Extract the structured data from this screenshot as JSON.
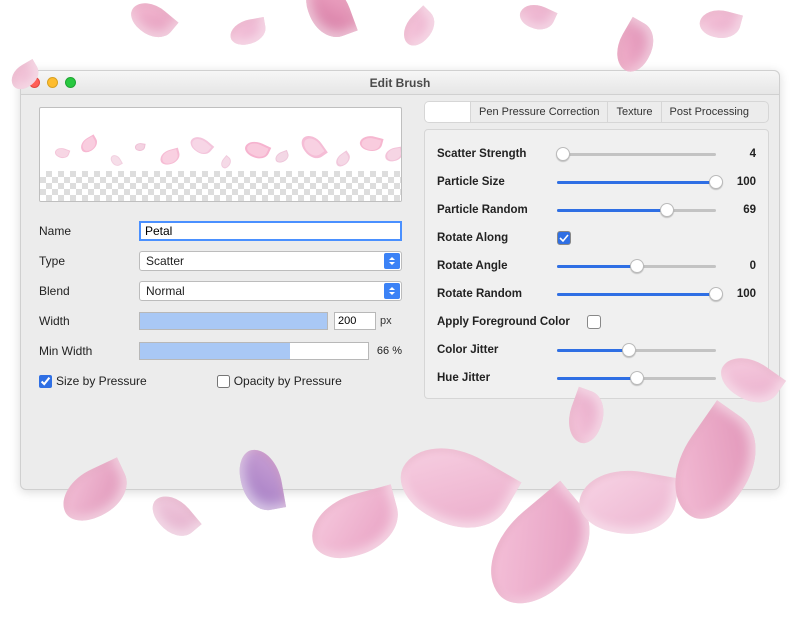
{
  "window": {
    "title": "Edit Brush"
  },
  "preview": {
    "alt": "petal brush stroke preview"
  },
  "left": {
    "name_label": "Name",
    "name_value": "Petal",
    "type_label": "Type",
    "type_value": "Scatter",
    "blend_label": "Blend",
    "blend_value": "Normal",
    "width_label": "Width",
    "width_value": "200",
    "width_unit": "px",
    "width_fill_pct": 100,
    "minwidth_label": "Min Width",
    "minwidth_value": "66 %",
    "minwidth_fill_pct": 66,
    "size_pressure_label": "Size by Pressure",
    "size_pressure_checked": true,
    "opacity_pressure_label": "Opacity by Pressure",
    "opacity_pressure_checked": false
  },
  "tabs": {
    "active": "",
    "items": [
      "",
      "Pen Pressure Correction",
      "Texture",
      "Post Processing"
    ]
  },
  "sliders": {
    "scatter_strength": {
      "label": "Scatter Strength",
      "value": 4,
      "min": 0,
      "max": 100
    },
    "particle_size": {
      "label": "Particle Size",
      "value": 100,
      "min": 0,
      "max": 100
    },
    "particle_random": {
      "label": "Particle Random",
      "value": 69,
      "min": 0,
      "max": 100
    },
    "rotate_along": {
      "label": "Rotate Along",
      "checked": true
    },
    "rotate_angle": {
      "label": "Rotate Angle",
      "value": 0,
      "display": "0",
      "pct": 50
    },
    "rotate_random": {
      "label": "Rotate Random",
      "value": 100,
      "min": 0,
      "max": 100
    },
    "apply_fg": {
      "label": "Apply Foreground Color",
      "checked": false
    },
    "color_jitter": {
      "label": "Color Jitter",
      "value": 45,
      "min": 0,
      "max": 100
    },
    "hue_jitter": {
      "label": "Hue Jitter",
      "value": 50,
      "min": 0,
      "max": 100
    }
  },
  "colors": {
    "accent": "#2f6fe4",
    "barfill": "#a9c8f5"
  }
}
